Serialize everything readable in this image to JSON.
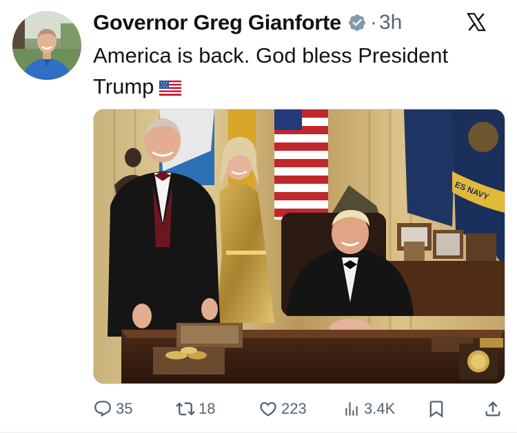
{
  "author": {
    "display_name": "Governor Greg Gianforte",
    "separator": "·",
    "time_ago": "3h",
    "verified": true
  },
  "tweet": {
    "text_line1": "America is back. God bless President",
    "text_line2": "Trump",
    "emoji": "us-flag"
  },
  "media": {
    "flag_text": "ES NAVY"
  },
  "actions": {
    "replies": "35",
    "reposts": "18",
    "likes": "223",
    "views": "3.4K"
  },
  "colors": {
    "text": "#0f1419",
    "secondary": "#536471",
    "verified_badge": "#829aab",
    "divider": "#eff3f4"
  },
  "icons": [
    "x-logo-icon",
    "verified-badge-icon",
    "reply-icon",
    "repost-icon",
    "like-icon",
    "views-icon",
    "bookmark-icon",
    "share-icon"
  ]
}
